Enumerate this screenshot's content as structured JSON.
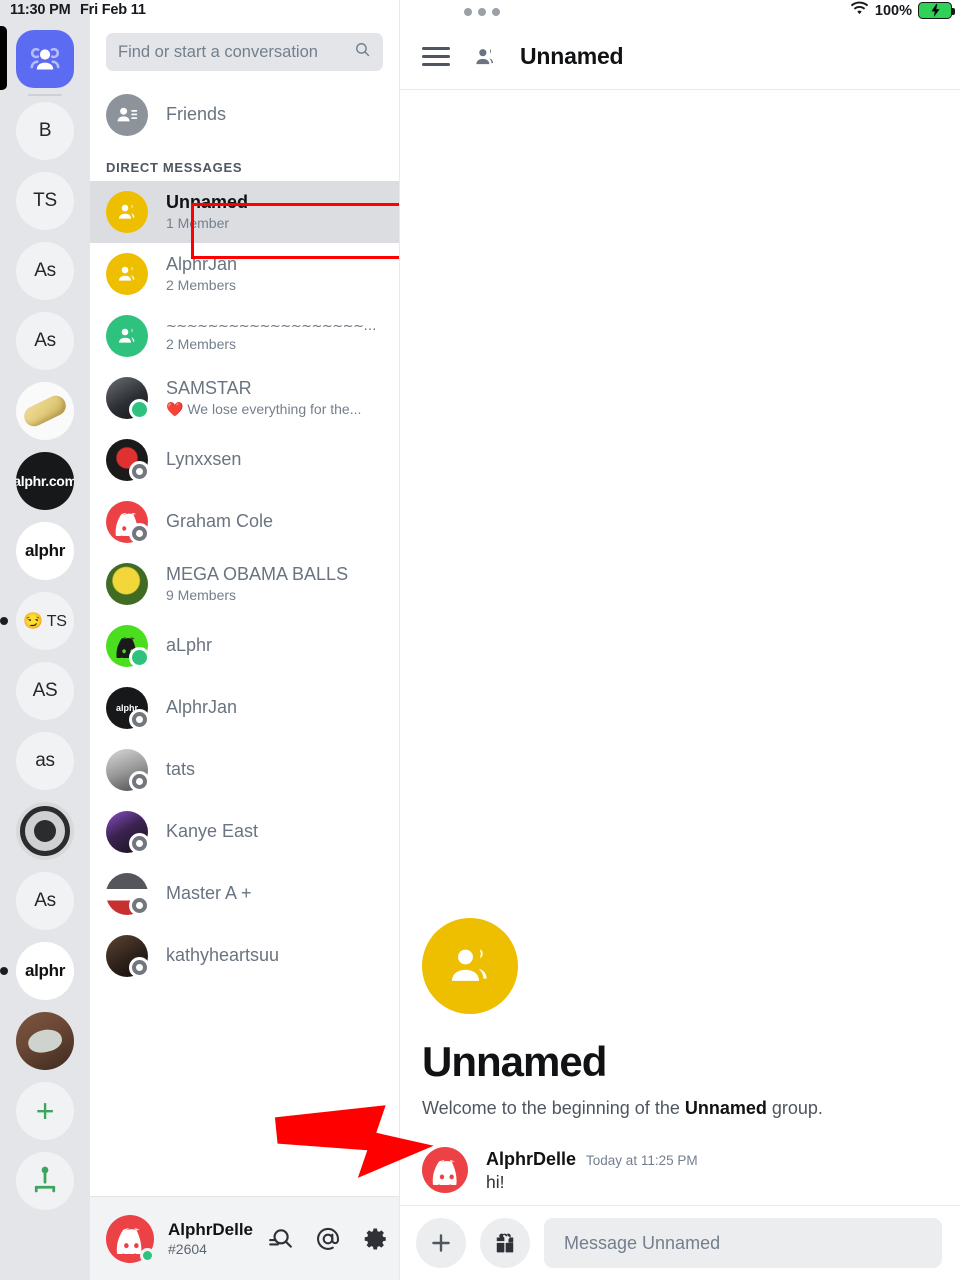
{
  "statusbar": {
    "time": "11:30 PM",
    "date": "Fri Feb 11",
    "battery_percent": "100%",
    "wifi_icon": "wifi-icon",
    "battery_icon": "battery-charging-icon",
    "multitask_icon": "multitask-dots-icon"
  },
  "colors": {
    "blurple": "#5c6cf2",
    "gold": "#eebf00",
    "green": "#2ec27e",
    "discord_red": "#ed4245",
    "annotation_red": "#ff0000",
    "rail_bg": "#e3e5e8",
    "selected_row": "#dcdde0"
  },
  "server_rail": {
    "items": [
      {
        "label": "",
        "icon": "home-people-icon",
        "type": "home",
        "active": true
      },
      {
        "label": "B",
        "type": "initials"
      },
      {
        "label": "TS",
        "type": "initials"
      },
      {
        "label": "As",
        "type": "initials"
      },
      {
        "label": "As",
        "type": "initials"
      },
      {
        "label": "",
        "type": "bread-image"
      },
      {
        "label": "alphr.com",
        "type": "dark-logo"
      },
      {
        "label": "alphr",
        "type": "white-logo"
      },
      {
        "label": "😏 TS",
        "type": "emoji-initials",
        "unread": true
      },
      {
        "label": "AS",
        "type": "initials"
      },
      {
        "label": "as",
        "type": "initials"
      },
      {
        "label": "",
        "type": "eye-image"
      },
      {
        "label": "As",
        "type": "initials"
      },
      {
        "label": "alphr",
        "type": "white-logo",
        "unread": true
      },
      {
        "label": "",
        "type": "cat-image"
      },
      {
        "label": "+",
        "type": "add-server"
      },
      {
        "label": "",
        "type": "explore-servers"
      }
    ]
  },
  "sidebar": {
    "search": {
      "placeholder": "Find or start a conversation",
      "icon": "search-icon"
    },
    "friends": {
      "label": "Friends",
      "icon": "friends-icon"
    },
    "section_header": "DIRECT MESSAGES",
    "dms": [
      {
        "name": "Unnamed",
        "sub": "1 Member",
        "avatar": "group-gold",
        "status": "none",
        "selected": true
      },
      {
        "name": "AlphrJan",
        "sub": "2 Members",
        "avatar": "group-gold",
        "status": "none"
      },
      {
        "name": "~~~~~~~~~~~~~~~~~~~~~~~~~",
        "sub": "2 Members",
        "avatar": "group-green",
        "status": "none",
        "squiggle": true
      },
      {
        "name": "SAMSTAR",
        "sub": "❤️ We lose everything for the...",
        "avatar": "photo-dark",
        "status": "online"
      },
      {
        "name": "Lynxxsen",
        "sub": "",
        "avatar": "photo-demon",
        "status": "offline"
      },
      {
        "name": "Graham Cole",
        "sub": "",
        "avatar": "discord-red",
        "status": "offline"
      },
      {
        "name": "MEGA OBAMA BALLS",
        "sub": "9 Members",
        "avatar": "photo-spongebob",
        "status": "none"
      },
      {
        "name": "aLphr",
        "sub": "",
        "avatar": "discord-green",
        "status": "online"
      },
      {
        "name": "AlphrJan",
        "sub": "",
        "avatar": "logo-dark",
        "status": "offline"
      },
      {
        "name": "tats",
        "sub": "",
        "avatar": "photo-gray",
        "status": "offline"
      },
      {
        "name": "Kanye East",
        "sub": "",
        "avatar": "photo-purple",
        "status": "offline"
      },
      {
        "name": "Master A +",
        "sub": "",
        "avatar": "photo-cap",
        "status": "offline"
      },
      {
        "name": "kathyheartsuu",
        "sub": "",
        "avatar": "photo-brown",
        "status": "offline"
      }
    ]
  },
  "userbar": {
    "name": "AlphrDelle",
    "tag": "#2604",
    "avatar": "discord-logo-avatar",
    "status": "online",
    "actions": [
      {
        "icon": "search-activity-icon",
        "name": "search-button"
      },
      {
        "icon": "mentions-at-icon",
        "name": "mentions-button"
      },
      {
        "icon": "gear-icon",
        "name": "settings-button"
      }
    ]
  },
  "chat": {
    "header": {
      "menu_icon": "hamburger-icon",
      "group_icon": "group-people-icon",
      "title": "Unnamed"
    },
    "welcome": {
      "avatar_icon": "group-people-icon",
      "title": "Unnamed",
      "intro_prefix": "Welcome to the beginning of the ",
      "intro_bold": "Unnamed",
      "intro_suffix": " group."
    },
    "messages": [
      {
        "author": "AlphrDelle",
        "timestamp": "Today at 11:25 PM",
        "content": "hi!",
        "avatar": "discord-logo-avatar"
      }
    ],
    "composer": {
      "add_icon": "plus-icon",
      "gift_icon": "gift-icon",
      "placeholder": "Message Unnamed"
    }
  },
  "annotations": {
    "arrow": {
      "color": "#ff0000",
      "points_to": "message-avatar",
      "name": "red-arrow-annotation"
    },
    "highlight_box": {
      "color": "#ff0000",
      "target": "sidebar-dm-unnamed",
      "name": "red-highlight-box"
    }
  }
}
